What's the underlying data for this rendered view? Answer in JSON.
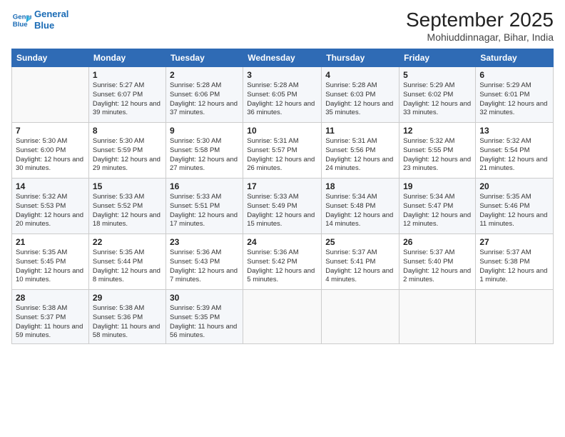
{
  "header": {
    "logo_line1": "General",
    "logo_line2": "Blue",
    "title": "September 2025",
    "location": "Mohiuddinnagar, Bihar, India"
  },
  "days_of_week": [
    "Sunday",
    "Monday",
    "Tuesday",
    "Wednesday",
    "Thursday",
    "Friday",
    "Saturday"
  ],
  "weeks": [
    [
      {
        "day": "",
        "sunrise": "",
        "sunset": "",
        "daylight": ""
      },
      {
        "day": "1",
        "sunrise": "Sunrise: 5:27 AM",
        "sunset": "Sunset: 6:07 PM",
        "daylight": "Daylight: 12 hours and 39 minutes."
      },
      {
        "day": "2",
        "sunrise": "Sunrise: 5:28 AM",
        "sunset": "Sunset: 6:06 PM",
        "daylight": "Daylight: 12 hours and 37 minutes."
      },
      {
        "day": "3",
        "sunrise": "Sunrise: 5:28 AM",
        "sunset": "Sunset: 6:05 PM",
        "daylight": "Daylight: 12 hours and 36 minutes."
      },
      {
        "day": "4",
        "sunrise": "Sunrise: 5:28 AM",
        "sunset": "Sunset: 6:03 PM",
        "daylight": "Daylight: 12 hours and 35 minutes."
      },
      {
        "day": "5",
        "sunrise": "Sunrise: 5:29 AM",
        "sunset": "Sunset: 6:02 PM",
        "daylight": "Daylight: 12 hours and 33 minutes."
      },
      {
        "day": "6",
        "sunrise": "Sunrise: 5:29 AM",
        "sunset": "Sunset: 6:01 PM",
        "daylight": "Daylight: 12 hours and 32 minutes."
      }
    ],
    [
      {
        "day": "7",
        "sunrise": "Sunrise: 5:30 AM",
        "sunset": "Sunset: 6:00 PM",
        "daylight": "Daylight: 12 hours and 30 minutes."
      },
      {
        "day": "8",
        "sunrise": "Sunrise: 5:30 AM",
        "sunset": "Sunset: 5:59 PM",
        "daylight": "Daylight: 12 hours and 29 minutes."
      },
      {
        "day": "9",
        "sunrise": "Sunrise: 5:30 AM",
        "sunset": "Sunset: 5:58 PM",
        "daylight": "Daylight: 12 hours and 27 minutes."
      },
      {
        "day": "10",
        "sunrise": "Sunrise: 5:31 AM",
        "sunset": "Sunset: 5:57 PM",
        "daylight": "Daylight: 12 hours and 26 minutes."
      },
      {
        "day": "11",
        "sunrise": "Sunrise: 5:31 AM",
        "sunset": "Sunset: 5:56 PM",
        "daylight": "Daylight: 12 hours and 24 minutes."
      },
      {
        "day": "12",
        "sunrise": "Sunrise: 5:32 AM",
        "sunset": "Sunset: 5:55 PM",
        "daylight": "Daylight: 12 hours and 23 minutes."
      },
      {
        "day": "13",
        "sunrise": "Sunrise: 5:32 AM",
        "sunset": "Sunset: 5:54 PM",
        "daylight": "Daylight: 12 hours and 21 minutes."
      }
    ],
    [
      {
        "day": "14",
        "sunrise": "Sunrise: 5:32 AM",
        "sunset": "Sunset: 5:53 PM",
        "daylight": "Daylight: 12 hours and 20 minutes."
      },
      {
        "day": "15",
        "sunrise": "Sunrise: 5:33 AM",
        "sunset": "Sunset: 5:52 PM",
        "daylight": "Daylight: 12 hours and 18 minutes."
      },
      {
        "day": "16",
        "sunrise": "Sunrise: 5:33 AM",
        "sunset": "Sunset: 5:51 PM",
        "daylight": "Daylight: 12 hours and 17 minutes."
      },
      {
        "day": "17",
        "sunrise": "Sunrise: 5:33 AM",
        "sunset": "Sunset: 5:49 PM",
        "daylight": "Daylight: 12 hours and 15 minutes."
      },
      {
        "day": "18",
        "sunrise": "Sunrise: 5:34 AM",
        "sunset": "Sunset: 5:48 PM",
        "daylight": "Daylight: 12 hours and 14 minutes."
      },
      {
        "day": "19",
        "sunrise": "Sunrise: 5:34 AM",
        "sunset": "Sunset: 5:47 PM",
        "daylight": "Daylight: 12 hours and 12 minutes."
      },
      {
        "day": "20",
        "sunrise": "Sunrise: 5:35 AM",
        "sunset": "Sunset: 5:46 PM",
        "daylight": "Daylight: 12 hours and 11 minutes."
      }
    ],
    [
      {
        "day": "21",
        "sunrise": "Sunrise: 5:35 AM",
        "sunset": "Sunset: 5:45 PM",
        "daylight": "Daylight: 12 hours and 10 minutes."
      },
      {
        "day": "22",
        "sunrise": "Sunrise: 5:35 AM",
        "sunset": "Sunset: 5:44 PM",
        "daylight": "Daylight: 12 hours and 8 minutes."
      },
      {
        "day": "23",
        "sunrise": "Sunrise: 5:36 AM",
        "sunset": "Sunset: 5:43 PM",
        "daylight": "Daylight: 12 hours and 7 minutes."
      },
      {
        "day": "24",
        "sunrise": "Sunrise: 5:36 AM",
        "sunset": "Sunset: 5:42 PM",
        "daylight": "Daylight: 12 hours and 5 minutes."
      },
      {
        "day": "25",
        "sunrise": "Sunrise: 5:37 AM",
        "sunset": "Sunset: 5:41 PM",
        "daylight": "Daylight: 12 hours and 4 minutes."
      },
      {
        "day": "26",
        "sunrise": "Sunrise: 5:37 AM",
        "sunset": "Sunset: 5:40 PM",
        "daylight": "Daylight: 12 hours and 2 minutes."
      },
      {
        "day": "27",
        "sunrise": "Sunrise: 5:37 AM",
        "sunset": "Sunset: 5:38 PM",
        "daylight": "Daylight: 12 hours and 1 minute."
      }
    ],
    [
      {
        "day": "28",
        "sunrise": "Sunrise: 5:38 AM",
        "sunset": "Sunset: 5:37 PM",
        "daylight": "Daylight: 11 hours and 59 minutes."
      },
      {
        "day": "29",
        "sunrise": "Sunrise: 5:38 AM",
        "sunset": "Sunset: 5:36 PM",
        "daylight": "Daylight: 11 hours and 58 minutes."
      },
      {
        "day": "30",
        "sunrise": "Sunrise: 5:39 AM",
        "sunset": "Sunset: 5:35 PM",
        "daylight": "Daylight: 11 hours and 56 minutes."
      },
      {
        "day": "",
        "sunrise": "",
        "sunset": "",
        "daylight": ""
      },
      {
        "day": "",
        "sunrise": "",
        "sunset": "",
        "daylight": ""
      },
      {
        "day": "",
        "sunrise": "",
        "sunset": "",
        "daylight": ""
      },
      {
        "day": "",
        "sunrise": "",
        "sunset": "",
        "daylight": ""
      }
    ]
  ]
}
